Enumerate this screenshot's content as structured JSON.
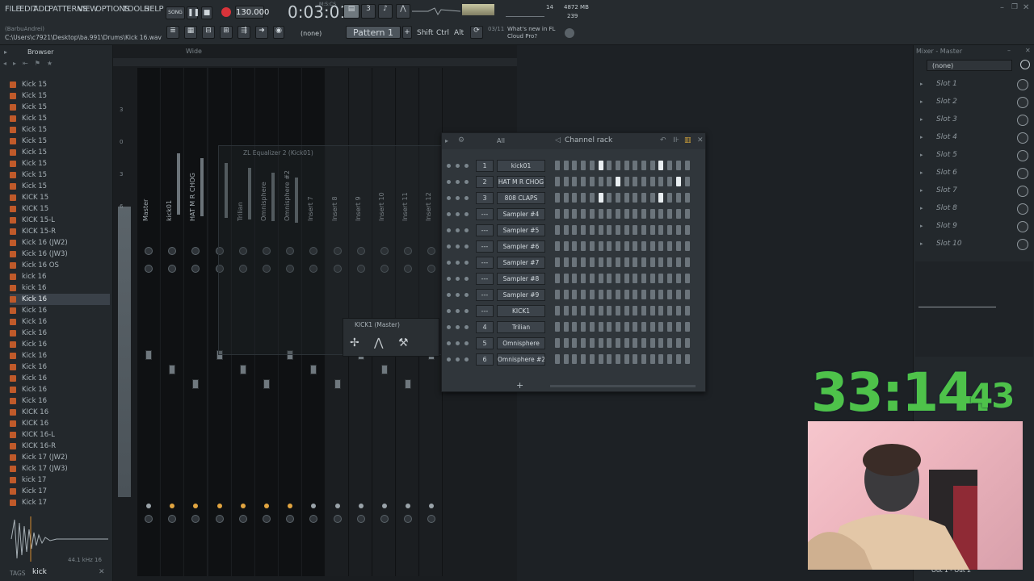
{
  "menubar": {
    "menu": [
      "FILE",
      "EDIT",
      "ADD",
      "PATTERNS",
      "VIEW",
      "OPTIONS",
      "TOOLS",
      "HELP"
    ],
    "song_mode": "SONG",
    "tempo": "130.000",
    "time": "0:03:01",
    "time_unit": "M:S:CS",
    "cpu_num": "14",
    "memory": "4872 MB",
    "polyphony": "239",
    "project_path_user": "(BarbuAndrei)",
    "project_path": "C:\\Users\\c7921\\Desktop\\ba.991\\Drums\\Kick 16.wav",
    "pattern_label": "Pattern 1",
    "snap": "(none)",
    "shift": "Shift",
    "ctrl": "Ctrl",
    "alt": "Alt",
    "news_counter": "03/11",
    "news_text": "What's new in FL Cloud Pro?"
  },
  "browser": {
    "title": "Browser",
    "files": [
      "Kick 15",
      "Kick 15",
      "Kick 15",
      "Kick 15",
      "Kick 15",
      "Kick 15",
      "Kick 15",
      "Kick 15",
      "Kick 15",
      "Kick 15",
      "KICK 15",
      "KICK 15",
      "KICK 15-L",
      "KICK 15-R",
      "Kick 16 (JW2)",
      "Kick 16 (JW3)",
      "Kick 16 OS",
      "kick 16",
      "kick 16",
      "Kick 16",
      "Kick 16",
      "Kick 16",
      "Kick 16",
      "Kick 16",
      "Kick 16",
      "Kick 16",
      "Kick 16",
      "Kick 16",
      "Kick 16",
      "KICK 16",
      "KICK 16",
      "KICK 16-L",
      "KICK 16-R",
      "Kick 17 (JW2)",
      "Kick 17 (JW3)",
      "kick 17",
      "Kick 17",
      "Kick 17"
    ],
    "selected_index": 19,
    "sample_info": "44.1 kHz 16",
    "tags_label": "TAGS",
    "search_value": "kick"
  },
  "mixer": {
    "view": "Wide",
    "strips": [
      "Master",
      "kick01",
      "HAT M R CHOG",
      "",
      "Trilian",
      "Omnisphere",
      "Omnisphere #2",
      "Insert 7",
      "Insert 8",
      "Insert 9",
      "Insert 10",
      "Insert 11",
      "Insert 12"
    ],
    "db_marks": [
      "3",
      "0",
      "3",
      "6"
    ],
    "eq_title": "ZL Equalizer 2 (Kick01)",
    "kick_panel_title": "KICK1 (Master)"
  },
  "channel_rack": {
    "filter": "All",
    "title": "Channel rack",
    "channels": [
      {
        "num": "1",
        "name": "kick01",
        "steps": [
          0,
          0,
          0,
          0,
          0,
          1,
          0,
          0,
          0,
          0,
          0,
          0,
          1,
          0,
          0,
          0
        ]
      },
      {
        "num": "2",
        "name": "HAT M R CHOG",
        "steps": [
          0,
          0,
          0,
          0,
          0,
          0,
          0,
          1,
          0,
          0,
          0,
          0,
          0,
          0,
          1,
          0
        ]
      },
      {
        "num": "3",
        "name": "808 CLAPS",
        "steps": [
          0,
          0,
          0,
          0,
          0,
          1,
          0,
          0,
          0,
          0,
          0,
          0,
          1,
          0,
          0,
          0
        ]
      },
      {
        "num": "---",
        "name": "Sampler #4",
        "steps": [
          0,
          0,
          0,
          0,
          0,
          0,
          0,
          0,
          0,
          0,
          0,
          0,
          0,
          0,
          0,
          0
        ]
      },
      {
        "num": "---",
        "name": "Sampler #5",
        "steps": [
          0,
          0,
          0,
          0,
          0,
          0,
          0,
          0,
          0,
          0,
          0,
          0,
          0,
          0,
          0,
          0
        ]
      },
      {
        "num": "---",
        "name": "Sampler #6",
        "steps": [
          0,
          0,
          0,
          0,
          0,
          0,
          0,
          0,
          0,
          0,
          0,
          0,
          0,
          0,
          0,
          0
        ]
      },
      {
        "num": "---",
        "name": "Sampler #7",
        "steps": [
          0,
          0,
          0,
          0,
          0,
          0,
          0,
          0,
          0,
          0,
          0,
          0,
          0,
          0,
          0,
          0
        ]
      },
      {
        "num": "---",
        "name": "Sampler #8",
        "steps": [
          0,
          0,
          0,
          0,
          0,
          0,
          0,
          0,
          0,
          0,
          0,
          0,
          0,
          0,
          0,
          0
        ]
      },
      {
        "num": "---",
        "name": "Sampler #9",
        "steps": [
          0,
          0,
          0,
          0,
          0,
          0,
          0,
          0,
          0,
          0,
          0,
          0,
          0,
          0,
          0,
          0
        ]
      },
      {
        "num": "---",
        "name": "KICK1",
        "steps": [
          0,
          0,
          0,
          0,
          0,
          0,
          0,
          0,
          0,
          0,
          0,
          0,
          0,
          0,
          0,
          0
        ]
      },
      {
        "num": "4",
        "name": "Trilian",
        "steps": [
          0,
          0,
          0,
          0,
          0,
          0,
          0,
          0,
          0,
          0,
          0,
          0,
          0,
          0,
          0,
          0
        ]
      },
      {
        "num": "5",
        "name": "Omnisphere",
        "steps": [
          0,
          0,
          0,
          0,
          0,
          0,
          0,
          0,
          0,
          0,
          0,
          0,
          0,
          0,
          0,
          0
        ]
      },
      {
        "num": "6",
        "name": "Omnisphere #2",
        "steps": [
          0,
          0,
          0,
          0,
          0,
          0,
          0,
          0,
          0,
          0,
          0,
          0,
          0,
          0,
          0,
          0
        ]
      }
    ],
    "add_label": "+"
  },
  "mixer_panel": {
    "title": "Mixer - Master",
    "preset": "(none)",
    "slots": [
      "Slot 1",
      "Slot 2",
      "Slot 3",
      "Slot 4",
      "Slot 5",
      "Slot 6",
      "Slot 7",
      "Slot 8",
      "Slot 9",
      "Slot 10"
    ],
    "output": "Out 1 - Out 2"
  },
  "timer": {
    "main": "33:14.",
    "fraction": "43"
  },
  "colors": {
    "accent_green": "#4ec24a",
    "step_on": "#e9eef1",
    "file_icon": "#c05a2a"
  }
}
